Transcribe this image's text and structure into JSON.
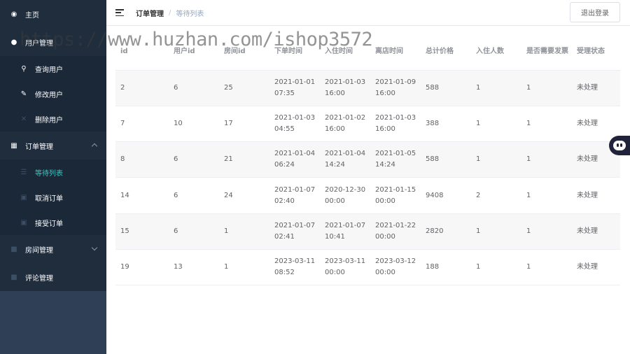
{
  "sidebar": {
    "items": [
      {
        "label": "主页",
        "icon": "dashboard-icon"
      },
      {
        "label": "用户管理",
        "icon": "user-icon"
      },
      {
        "label": "查询用户",
        "icon": "search-icon"
      },
      {
        "label": "修改用户",
        "icon": "edit-icon"
      },
      {
        "label": "删除用户",
        "icon": "close-icon"
      },
      {
        "label": "订单管理",
        "icon": "document-icon"
      },
      {
        "label": "等待列表",
        "icon": "list-icon"
      },
      {
        "label": "取消订单",
        "icon": "cancel-order-icon"
      },
      {
        "label": "接受订单",
        "icon": "accept-order-icon"
      },
      {
        "label": "房间管理",
        "icon": "room-icon"
      },
      {
        "label": "评论管理",
        "icon": "comment-icon"
      }
    ],
    "active_color": "#38c9c0"
  },
  "header": {
    "breadcrumb": [
      "订单管理",
      "等待列表"
    ],
    "separator": "/",
    "logout_label": "退出登录"
  },
  "table": {
    "columns": [
      "id",
      "用户id",
      "房间id",
      "下单时间",
      "入住时间",
      "离店时间",
      "总计价格",
      "入住人数",
      "是否需要发票",
      "受理状态"
    ],
    "rows": [
      [
        "2",
        "6",
        "25",
        "2021-01-01 07:35",
        "2021-01-03 16:00",
        "2021-01-09 16:00",
        "588",
        "1",
        "1",
        "未处理"
      ],
      [
        "7",
        "10",
        "17",
        "2021-01-03 04:55",
        "2021-01-02 16:00",
        "2021-01-03 16:00",
        "388",
        "1",
        "1",
        "未处理"
      ],
      [
        "8",
        "6",
        "21",
        "2021-01-04 06:24",
        "2021-01-04 14:24",
        "2021-01-05 14:24",
        "588",
        "1",
        "1",
        "未处理"
      ],
      [
        "14",
        "6",
        "24",
        "2021-01-07 02:40",
        "2020-12-30 00:00",
        "2021-01-15 00:00",
        "9408",
        "2",
        "1",
        "未处理"
      ],
      [
        "15",
        "6",
        "1",
        "2021-01-07 02:41",
        "2021-01-07 10:41",
        "2021-01-22 00:00",
        "2820",
        "1",
        "1",
        "未处理"
      ],
      [
        "19",
        "13",
        "1",
        "2023-03-11 08:52",
        "2023-03-11 00:00",
        "2023-03-12 00:00",
        "188",
        "1",
        "1",
        "未处理"
      ]
    ]
  },
  "watermark": "https://www.huzhan.com/ishop3572"
}
